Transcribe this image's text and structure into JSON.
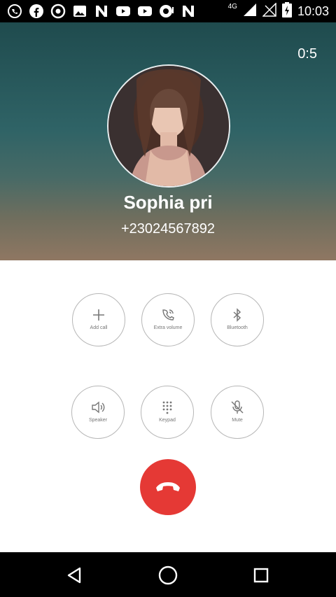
{
  "status_bar": {
    "time": "10:03",
    "network": "4G",
    "icons": [
      "whatsapp-icon",
      "facebook-icon",
      "chrome-icon",
      "image-icon",
      "n-icon",
      "youtube-icon",
      "youtube-icon",
      "opera-icon",
      "n-icon"
    ]
  },
  "call": {
    "timer": "0:5",
    "name": "Sophia pri",
    "number": "+23024567892"
  },
  "controls": {
    "add_call": "Add call",
    "extra_volume": "Extra volume",
    "bluetooth": "Bluetooth",
    "speaker": "Speaker",
    "keypad": "Keypad",
    "mute": "Mute"
  },
  "colors": {
    "end_call": "#e53935",
    "header_top": "#1f4b4e",
    "header_bottom": "#8f7762"
  }
}
